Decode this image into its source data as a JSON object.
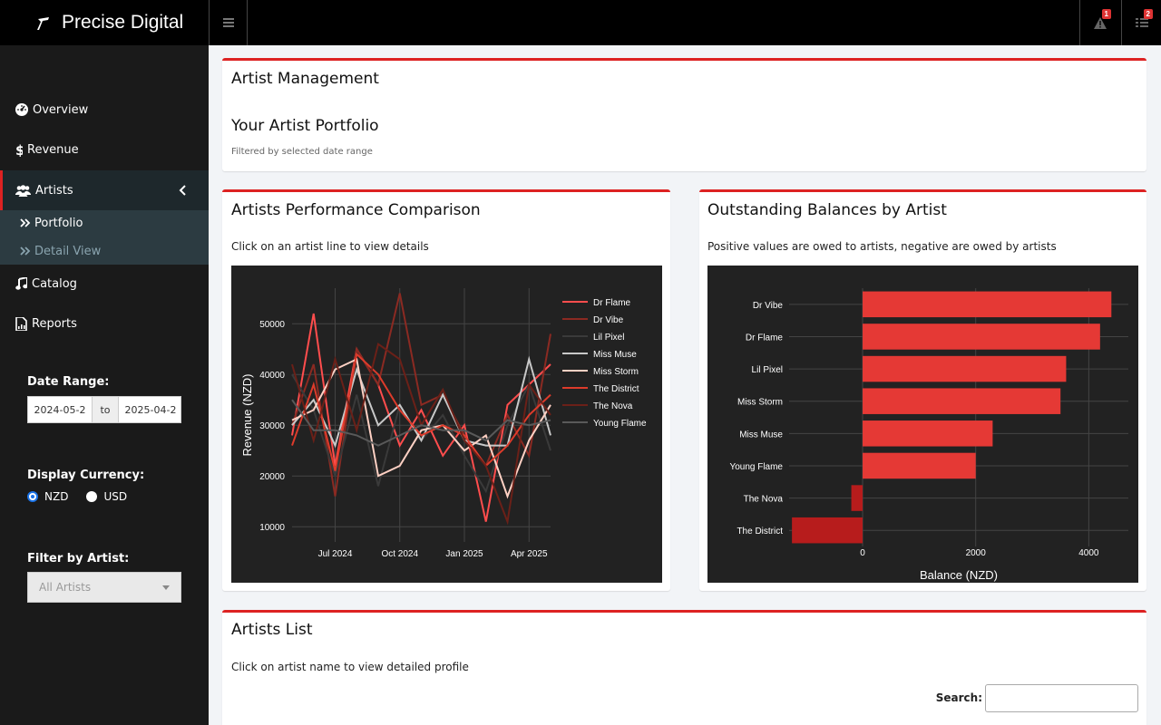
{
  "header": {
    "brand": "Precise Digital",
    "alerts_badge": "1",
    "tasks_badge": "2"
  },
  "sidebar": {
    "items": [
      {
        "label": "Overview",
        "icon": "dashboard-icon"
      },
      {
        "label": "Revenue",
        "icon": "dollar-icon"
      },
      {
        "label": "Artists",
        "icon": "users-icon"
      },
      {
        "label": "Catalog",
        "icon": "music-icon"
      },
      {
        "label": "Reports",
        "icon": "file-chart-icon"
      }
    ],
    "submenu": [
      {
        "label": "Portfolio"
      },
      {
        "label": "Detail View"
      }
    ],
    "date_range": {
      "label": "Date Range:",
      "start": "2024-05-2",
      "separator": "to",
      "end": "2025-04-2"
    },
    "currency": {
      "label": "Display Currency:",
      "options": [
        "NZD",
        "USD"
      ],
      "selected": "NZD"
    },
    "artist_filter": {
      "label": "Filter by Artist:",
      "placeholder": "All Artists"
    }
  },
  "colors": {
    "accent": "#dd2222",
    "sidebar_bg": "#1a1a1a",
    "submenu_bg": "#2c3b41",
    "plot_bg": "#222222"
  },
  "artist_management": {
    "title": "Artist Management",
    "subtitle": "Your Artist Portfolio",
    "note": "Filtered by selected date range"
  },
  "performance_box": {
    "title": "Artists Performance Comparison",
    "subtitle": "Click on an artist line to view details"
  },
  "balances_box": {
    "title": "Outstanding Balances by Artist",
    "subtitle": "Positive values are owed to artists, negative are owed by artists"
  },
  "artists_list": {
    "title": "Artists List",
    "subtitle": "Click on artist name to view detailed profile",
    "search_label": "Search:"
  },
  "chart_data": [
    {
      "type": "line",
      "title": "",
      "xlabel": "",
      "ylabel": "Revenue (NZD)",
      "x": [
        "2024-05",
        "2024-06",
        "2024-07",
        "2024-08",
        "2024-09",
        "2024-10",
        "2024-11",
        "2024-12",
        "2025-01",
        "2025-02",
        "2025-03",
        "2025-04",
        "2025-05"
      ],
      "xticks": [
        "Jul 2024",
        "Oct 2024",
        "Jan 2025",
        "Apr 2025"
      ],
      "yticks": [
        "10000",
        "20000",
        "30000",
        "40000",
        "50000"
      ],
      "ylim": [
        7000,
        57000
      ],
      "grid": true,
      "legend": "right",
      "series": [
        {
          "name": "Dr Flame",
          "color": "#ff4d4d",
          "values": [
            28000,
            52000,
            22000,
            45000,
            38000,
            26000,
            33000,
            24000,
            30000,
            11000,
            34000,
            38000,
            42000
          ]
        },
        {
          "name": "Dr Vibe",
          "color": "#8b2a22",
          "values": [
            30000,
            42000,
            16000,
            45000,
            38000,
            56000,
            34000,
            36000,
            28000,
            22000,
            32000,
            24000,
            48000
          ]
        },
        {
          "name": "Lil Pixel",
          "color": "#3a3a3a",
          "values": [
            40000,
            33000,
            20000,
            36000,
            18000,
            34000,
            27000,
            32000,
            24000,
            17000,
            30000,
            38000,
            25000
          ]
        },
        {
          "name": "Miss Muse",
          "color": "#c8c8c8",
          "values": [
            30000,
            35000,
            26000,
            41000,
            30000,
            34000,
            27000,
            36000,
            27000,
            26000,
            26000,
            43000,
            28000
          ]
        },
        {
          "name": "Miss Storm",
          "color": "#ffd1c4",
          "values": [
            31000,
            33000,
            41000,
            43000,
            20000,
            22000,
            29000,
            30000,
            25000,
            28000,
            16000,
            27000,
            34000
          ]
        },
        {
          "name": "The District",
          "color": "#dd3b2b",
          "values": [
            26000,
            38000,
            21000,
            44000,
            40000,
            33000,
            28000,
            30000,
            28000,
            22000,
            26000,
            32000,
            36000
          ]
        },
        {
          "name": "The Nova",
          "color": "#6b2018",
          "values": [
            42000,
            27000,
            43000,
            29000,
            46000,
            43000,
            30000,
            37000,
            27000,
            22000,
            11000,
            38000,
            32000
          ]
        },
        {
          "name": "Young Flame",
          "color": "#595959",
          "values": [
            35000,
            29000,
            29000,
            28000,
            26000,
            28000,
            30000,
            29000,
            29000,
            27000,
            31000,
            30000,
            31000
          ]
        }
      ]
    },
    {
      "type": "bar",
      "orientation": "horizontal",
      "title": "",
      "xlabel": "Balance (NZD)",
      "ylabel": "",
      "categories": [
        "Dr Vibe",
        "Dr Flame",
        "Lil Pixel",
        "Miss Storm",
        "Miss Muse",
        "Young Flame",
        "The Nova",
        "The District"
      ],
      "values": [
        4400,
        4200,
        3600,
        3500,
        2300,
        2000,
        -200,
        -1250
      ],
      "xticks": [
        "0",
        "2000",
        "4000"
      ],
      "xlim": [
        -1300,
        4700
      ],
      "grid": true,
      "colors": {
        "positive": "#e53935",
        "negative": "#b71c1c"
      }
    }
  ]
}
